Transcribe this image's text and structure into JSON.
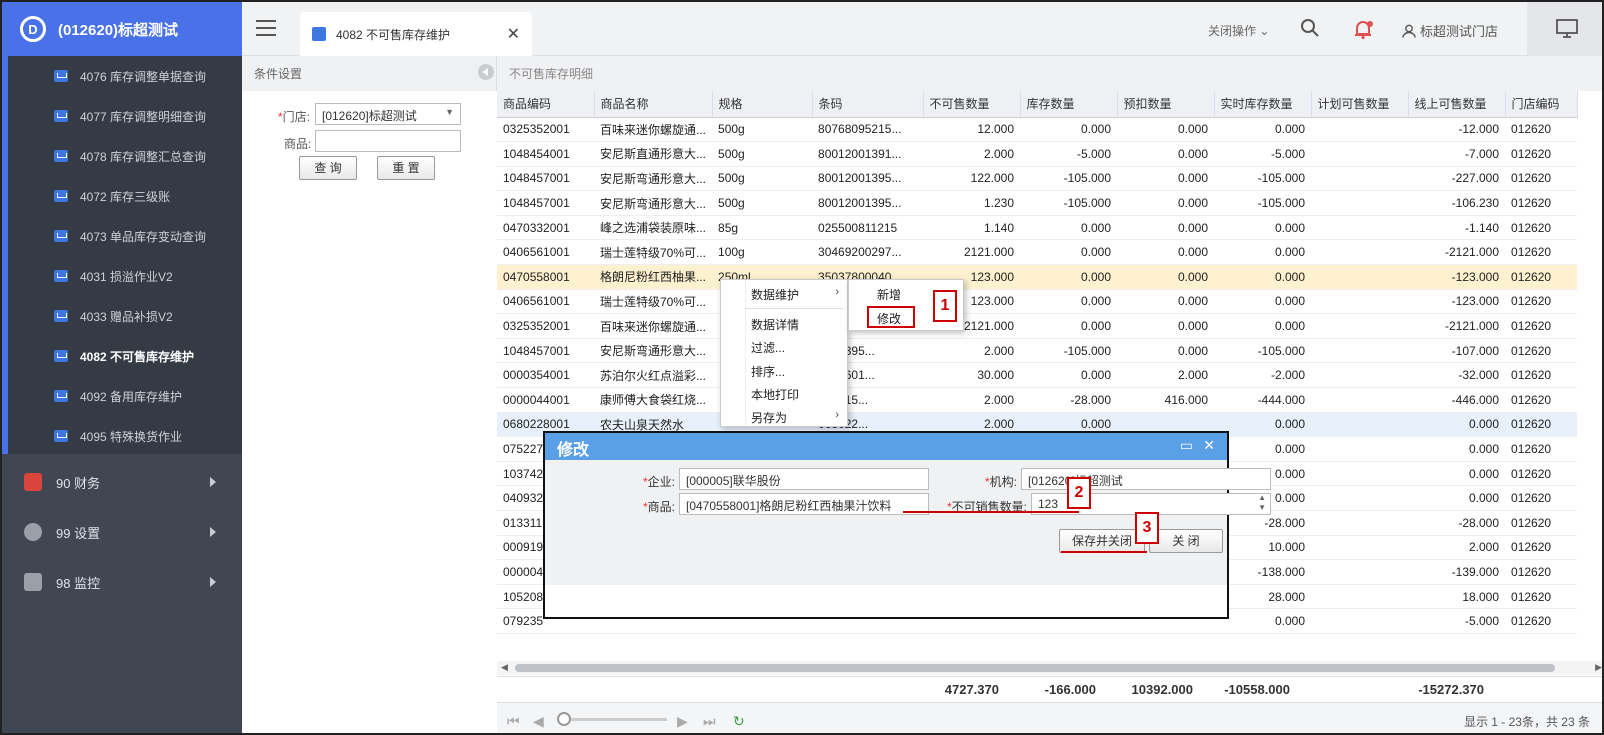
{
  "app": {
    "title": "(012620)标超测试"
  },
  "sidebar": {
    "submenu": [
      {
        "label": "4076 库存调整单据查询"
      },
      {
        "label": "4077 库存调整明细查询"
      },
      {
        "label": "4078 库存调整汇总查询"
      },
      {
        "label": "4072 库存三级账"
      },
      {
        "label": "4073 单品库存变动查询"
      },
      {
        "label": "4031 损溢作业V2"
      },
      {
        "label": "4033 赠品补损V2"
      },
      {
        "label": "4082 不可售库存维护",
        "active": true
      },
      {
        "label": "4092 备用库存维护"
      },
      {
        "label": "4095 特殊换货作业"
      }
    ],
    "menu": [
      {
        "label": "90 财务",
        "icon": "finance-icon"
      },
      {
        "label": "99 设置",
        "icon": "settings-gear-icon"
      },
      {
        "label": "98 监控",
        "icon": "monitor-user-icon"
      }
    ]
  },
  "header": {
    "tab_label": "4082 不可售库存维护",
    "close_ops": "关闭操作",
    "user": "标超测试门店"
  },
  "filter": {
    "title": "条件设置",
    "store_label": "门店:",
    "store_value": "[012620]标超测试",
    "product_label": "商品:",
    "product_value": "",
    "query_btn": "查 询",
    "reset_btn": "重 置"
  },
  "grid": {
    "title": "不可售库存明细",
    "columns": [
      "商品编码",
      "商品名称",
      "规格",
      "条码",
      "不可售数量",
      "库存数量",
      "预扣数量",
      "实时库存数量",
      "计划可售数量",
      "线上可售数量",
      "门店编码"
    ],
    "rows": [
      [
        "0325352001",
        "百味来迷你螺旋通...",
        "500g",
        "80768095215...",
        "12.000",
        "0.000",
        "0.000",
        "0.000",
        "",
        "-12.000",
        "012620"
      ],
      [
        "1048454001",
        "安尼斯直通形意大...",
        "500g",
        "80012001391...",
        "2.000",
        "-5.000",
        "0.000",
        "-5.000",
        "",
        "-7.000",
        "012620"
      ],
      [
        "1048457001",
        "安尼斯弯通形意大...",
        "500g",
        "80012001395...",
        "122.000",
        "-105.000",
        "0.000",
        "-105.000",
        "",
        "-227.000",
        "012620"
      ],
      [
        "1048457001",
        "安尼斯弯通形意大...",
        "500g",
        "80012001395...",
        "1.230",
        "-105.000",
        "0.000",
        "-105.000",
        "",
        "-106.230",
        "012620"
      ],
      [
        "0470332001",
        "峰之选浦袋装原味...",
        "85g",
        "025500811215",
        "1.140",
        "0.000",
        "0.000",
        "0.000",
        "",
        "-1.140",
        "012620"
      ],
      [
        "0406561001",
        "瑞士莲特级70%可...",
        "100g",
        "30469200297...",
        "2121.000",
        "0.000",
        "0.000",
        "0.000",
        "",
        "-2121.000",
        "012620"
      ],
      [
        "0470558001",
        "格朗尼粉红西柚果...",
        "250ml",
        "35037800040...",
        "123.000",
        "0.000",
        "0.000",
        "0.000",
        "",
        "-123.000",
        "012620"
      ],
      [
        "0406561001",
        "瑞士莲特级70%可...",
        "",
        "",
        "123.000",
        "0.000",
        "0.000",
        "0.000",
        "",
        "-123.000",
        "012620"
      ],
      [
        "0325352001",
        "百味来迷你螺旋通...",
        "",
        "",
        "2121.000",
        "0.000",
        "0.000",
        "0.000",
        "",
        "-2121.000",
        "012620"
      ],
      [
        "1048457001",
        "安尼斯弯通形意大...",
        "",
        "2001395...",
        "2.000",
        "-105.000",
        "0.000",
        "-105.000",
        "",
        "-107.000",
        "012620"
      ],
      [
        "0000354001",
        "苏泊尔火红点溢彩...",
        "",
        "8555601...",
        "30.000",
        "0.000",
        "2.000",
        "-2.000",
        "",
        "-32.000",
        "012620"
      ],
      [
        "0000044001",
        "康师傅大食袋红烧...",
        "",
        "524715...",
        "2.000",
        "-28.000",
        "416.000",
        "-444.000",
        "",
        "-446.000",
        "012620"
      ],
      [
        "0680228001",
        "农夫山泉天然水",
        "",
        "068022...",
        "2.000",
        "0.000",
        "",
        "0.000",
        "",
        "0.000",
        "012620"
      ],
      [
        "075227",
        "",
        "",
        "",
        "",
        "",
        "",
        "0.000",
        "",
        "0.000",
        "012620"
      ],
      [
        "103742",
        "",
        "",
        "",
        "",
        "",
        "",
        "0.000",
        "",
        "0.000",
        "012620"
      ],
      [
        "040932",
        "",
        "",
        "",
        "",
        "",
        "",
        "0.000",
        "",
        "0.000",
        "012620"
      ],
      [
        "013311",
        "",
        "",
        "",
        "",
        "",
        "",
        "-28.000",
        "",
        "-28.000",
        "012620"
      ],
      [
        "000919",
        "",
        "",
        "",
        "",
        "",
        "",
        "10.000",
        "",
        "2.000",
        "012620"
      ],
      [
        "000004",
        "",
        "",
        "",
        "",
        "",
        "",
        "-138.000",
        "",
        "-139.000",
        "012620"
      ],
      [
        "105208",
        "",
        "",
        "",
        "",
        "",
        "",
        "28.000",
        "",
        "18.000",
        "012620"
      ],
      [
        "079235",
        "",
        "",
        "",
        "",
        "",
        "",
        "0.000",
        "",
        "-5.000",
        "012620"
      ]
    ],
    "totals": [
      "4727.370",
      "-166.000",
      "10392.000",
      "-10558.000",
      "-15272.370"
    ],
    "pager_info": "显示 1 - 23条，共 23 条"
  },
  "context_menu": {
    "items": [
      "数据维护",
      "数据详情",
      "过滤...",
      "排序...",
      "本地打印",
      "另存为"
    ],
    "sub_items": [
      "新增",
      "修改"
    ]
  },
  "annotations": [
    "1",
    "2",
    "3"
  ],
  "modal": {
    "title": "修改",
    "company_label": "企业:",
    "company_value": "[000005]联华股份",
    "org_label": "机构:",
    "org_value": "[012620]标超测试",
    "product_label": "商品:",
    "product_value": "[0470558001]格朗尼粉红西柚果汁饮料",
    "qty_label": "不可销售数量:",
    "qty_value": "123",
    "save_btn": "保存并关闭",
    "close_btn": "关 闭"
  },
  "colors": {
    "accent": "#4a72e8",
    "sidebar": "#404652",
    "selected_row": "#fdf1cf",
    "annotation": "#cc0000"
  }
}
